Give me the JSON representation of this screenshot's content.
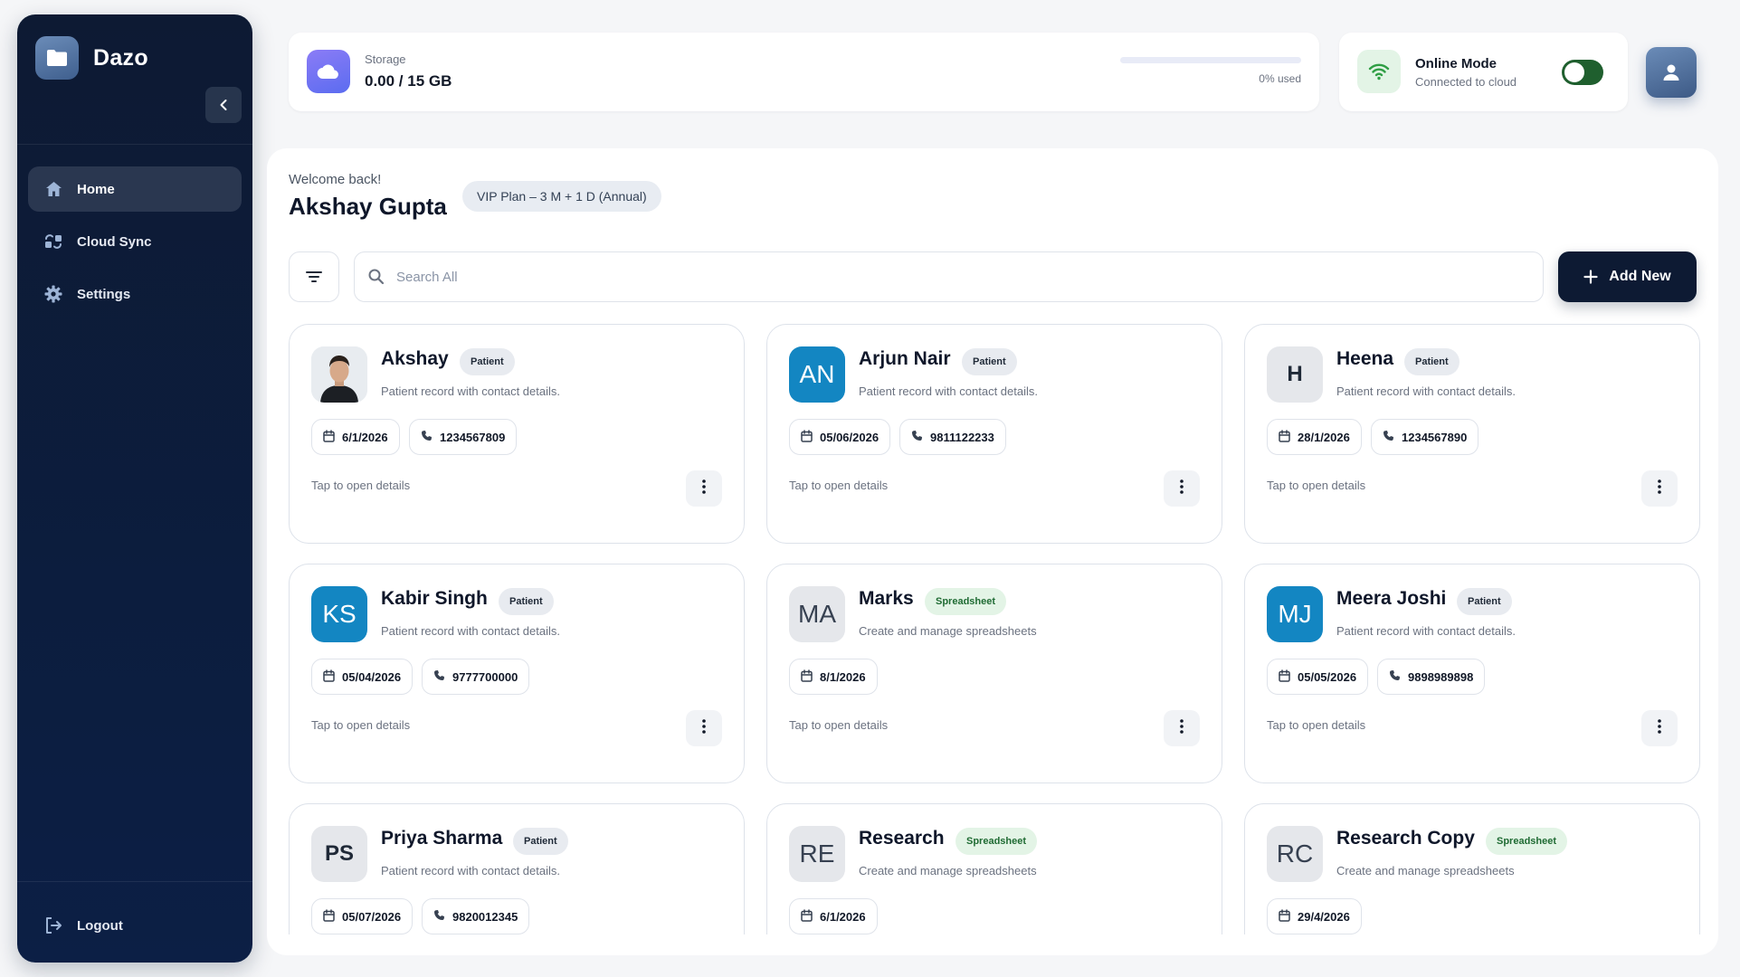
{
  "app": {
    "name": "Dazo"
  },
  "sidebar": {
    "items": [
      {
        "label": "Home",
        "icon": "home-icon",
        "active": true
      },
      {
        "label": "Cloud Sync",
        "icon": "cloud-sync-icon",
        "active": false
      },
      {
        "label": "Settings",
        "icon": "gear-icon",
        "active": false
      }
    ],
    "logout_label": "Logout"
  },
  "storage": {
    "label": "Storage",
    "value": "0.00 / 15 GB",
    "used_text": "0% used",
    "used_fraction": 0
  },
  "online": {
    "title": "Online Mode",
    "subtitle": "Connected to cloud",
    "enabled": true
  },
  "header": {
    "welcome": "Welcome back!",
    "user_name": "Akshay Gupta",
    "plan": "VIP Plan – 3 M + 1 D (Annual)"
  },
  "search": {
    "placeholder": "Search All"
  },
  "add_button": {
    "label": "Add New"
  },
  "colors": {
    "sidebar": "#0d1a33",
    "accent_blue": "#1386c2",
    "storage_accent": "#5b6cf0",
    "online_green": "#1f5f2e",
    "spreadsheet_badge": "#e3f4e6"
  },
  "cards": [
    {
      "name": "Akshay",
      "badge": "Patient",
      "badge_type": "patient",
      "desc": "Patient record with contact details.",
      "date": "6/1/2026",
      "phone": "1234567809",
      "footer": "Tap to open details",
      "avatar": {
        "type": "photo",
        "initials": ""
      }
    },
    {
      "name": "Arjun Nair",
      "badge": "Patient",
      "badge_type": "patient",
      "desc": "Patient record with contact details.",
      "date": "05/06/2026",
      "phone": "9811122233",
      "footer": "Tap to open details",
      "avatar": {
        "type": "blue",
        "initials": "AN"
      }
    },
    {
      "name": "Heena",
      "badge": "Patient",
      "badge_type": "patient",
      "desc": "Patient record with contact details.",
      "date": "28/1/2026",
      "phone": "1234567890",
      "footer": "Tap to open details",
      "avatar": {
        "type": "grey",
        "initials": "H"
      }
    },
    {
      "name": "Kabir Singh",
      "badge": "Patient",
      "badge_type": "patient",
      "desc": "Patient record with contact details.",
      "date": "05/04/2026",
      "phone": "9777700000",
      "footer": "Tap to open details",
      "avatar": {
        "type": "blue",
        "initials": "KS"
      }
    },
    {
      "name": "Marks",
      "badge": "Spreadsheet",
      "badge_type": "sheet",
      "desc": "Create and manage spreadsheets",
      "date": "8/1/2026",
      "phone": "",
      "footer": "Tap to open details",
      "avatar": {
        "type": "grey-light",
        "initials": "MA"
      }
    },
    {
      "name": "Meera Joshi",
      "badge": "Patient",
      "badge_type": "patient",
      "desc": "Patient record with contact details.",
      "date": "05/05/2026",
      "phone": "9898989898",
      "footer": "Tap to open details",
      "avatar": {
        "type": "blue",
        "initials": "MJ"
      }
    },
    {
      "name": "Priya Sharma",
      "badge": "Patient",
      "badge_type": "patient",
      "desc": "Patient record with contact details.",
      "date": "05/07/2026",
      "phone": "9820012345",
      "footer": "",
      "avatar": {
        "type": "grey",
        "initials": "PS"
      }
    },
    {
      "name": "Research",
      "badge": "Spreadsheet",
      "badge_type": "sheet",
      "desc": "Create and manage spreadsheets",
      "date": "6/1/2026",
      "phone": "",
      "footer": "",
      "avatar": {
        "type": "grey-light",
        "initials": "RE"
      }
    },
    {
      "name": "Research Copy",
      "badge": "Spreadsheet",
      "badge_type": "sheet",
      "desc": "Create and manage spreadsheets",
      "date": "29/4/2026",
      "phone": "",
      "footer": "",
      "avatar": {
        "type": "grey-light",
        "initials": "RC"
      }
    }
  ]
}
